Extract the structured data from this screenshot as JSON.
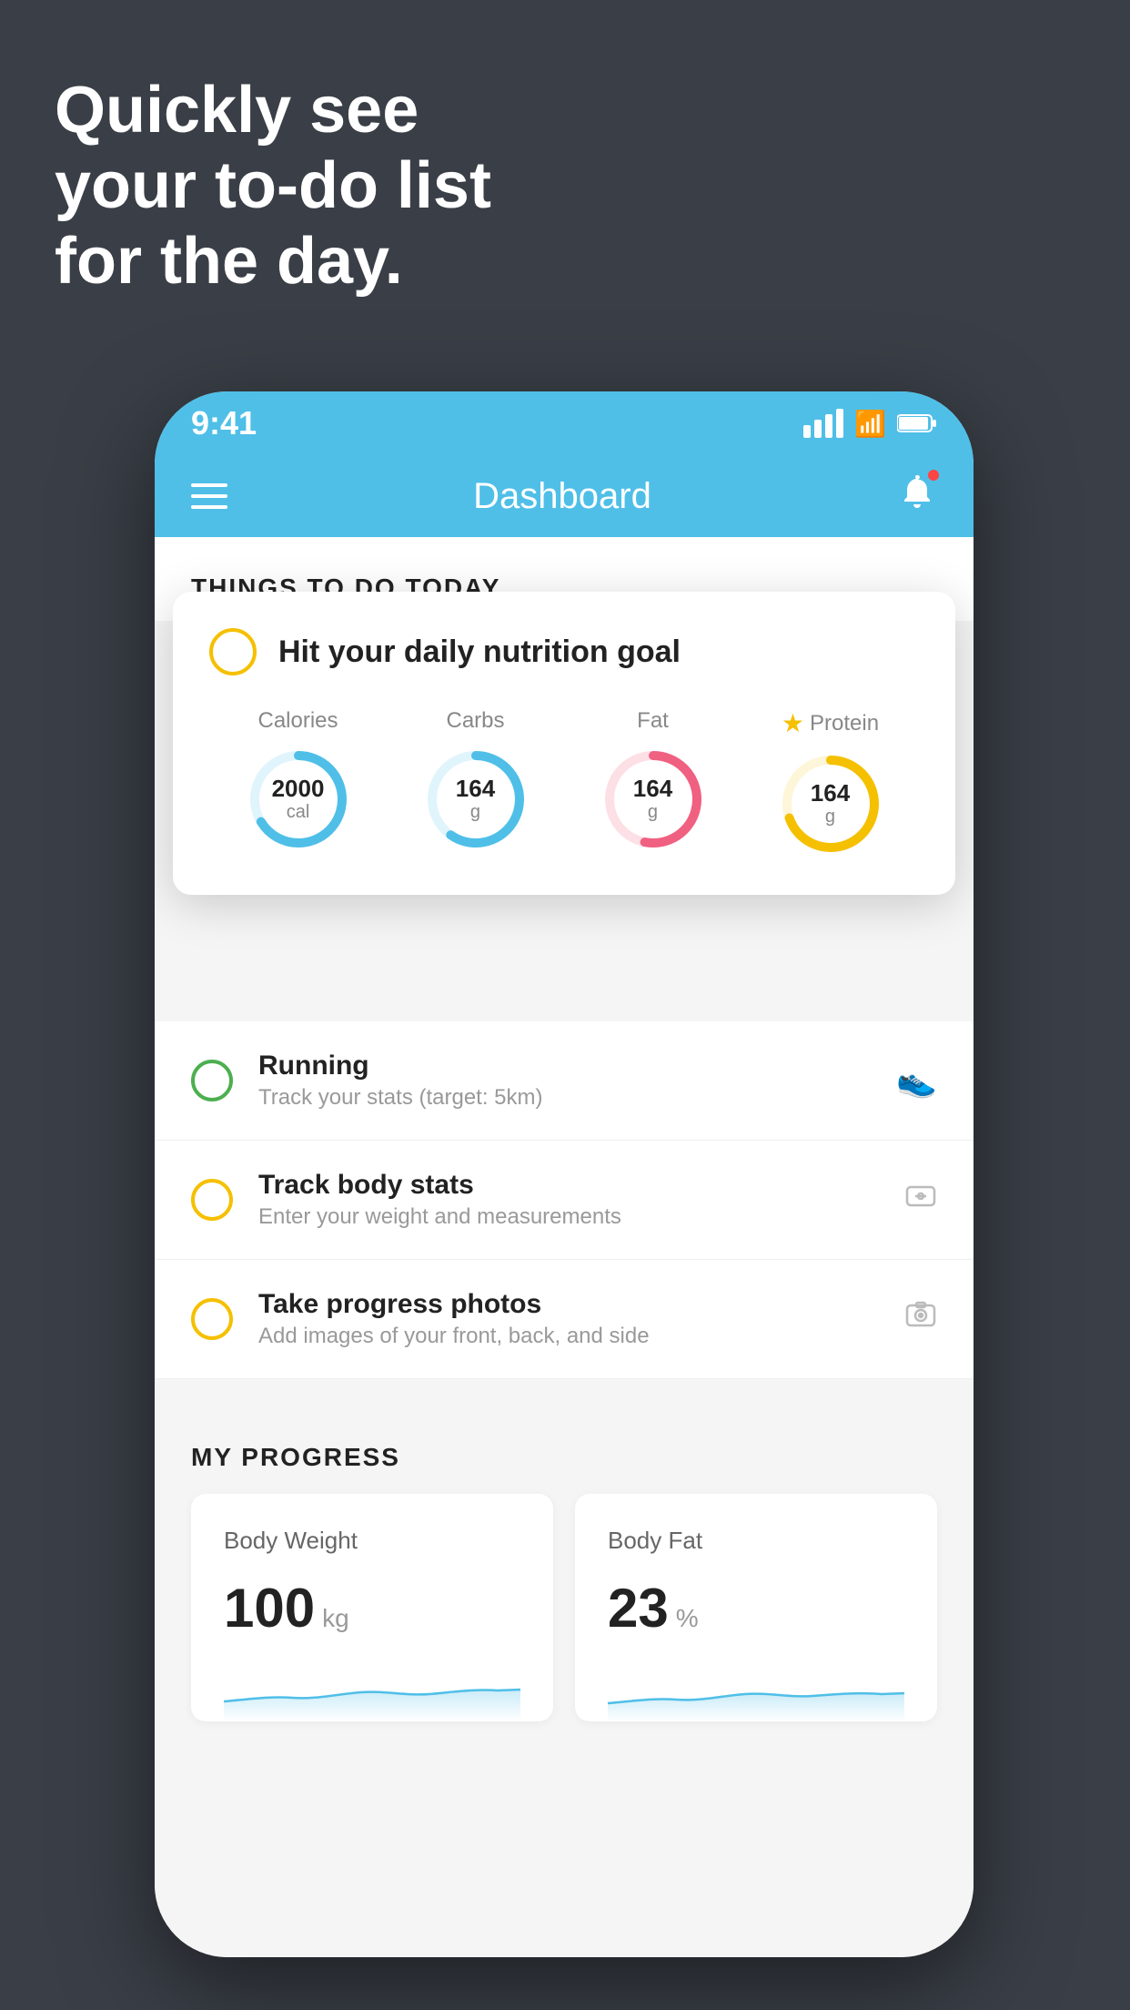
{
  "hero": {
    "line1": "Quickly see",
    "line2": "your to-do list",
    "line3": "for the day."
  },
  "status_bar": {
    "time": "9:41",
    "signal": "signal",
    "wifi": "wifi",
    "battery": "battery"
  },
  "nav": {
    "title": "Dashboard",
    "menu_label": "menu",
    "bell_label": "notifications"
  },
  "things_section": {
    "heading": "THINGS TO DO TODAY"
  },
  "floating_card": {
    "title": "Hit your daily nutrition goal",
    "nutrients": [
      {
        "label": "Calories",
        "value": "2000",
        "unit": "cal",
        "color": "#4fbfe8",
        "track_color": "#e0f4fc",
        "star": false
      },
      {
        "label": "Carbs",
        "value": "164",
        "unit": "g",
        "color": "#4fbfe8",
        "track_color": "#e0f4fc",
        "star": false
      },
      {
        "label": "Fat",
        "value": "164",
        "unit": "g",
        "color": "#f06080",
        "track_color": "#fce0e6",
        "star": false
      },
      {
        "label": "Protein",
        "value": "164",
        "unit": "g",
        "color": "#f5c000",
        "track_color": "#fef6d8",
        "star": true
      }
    ]
  },
  "todo_items": [
    {
      "title": "Running",
      "subtitle": "Track your stats (target: 5km)",
      "circle_color": "green",
      "icon": "shoe"
    },
    {
      "title": "Track body stats",
      "subtitle": "Enter your weight and measurements",
      "circle_color": "yellow",
      "icon": "scale"
    },
    {
      "title": "Take progress photos",
      "subtitle": "Add images of your front, back, and side",
      "circle_color": "yellow",
      "icon": "photo"
    }
  ],
  "progress": {
    "heading": "MY PROGRESS",
    "cards": [
      {
        "title": "Body Weight",
        "value": "100",
        "unit": "kg"
      },
      {
        "title": "Body Fat",
        "value": "23",
        "unit": "%"
      }
    ]
  }
}
